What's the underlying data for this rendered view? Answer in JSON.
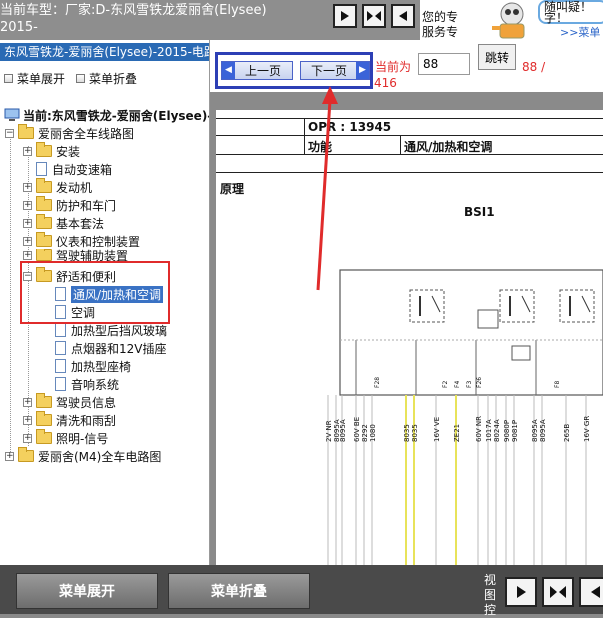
{
  "top": {
    "vehicle_line1": "当前车型：厂家:D-东风雪铁龙爱丽舍(Elysee)",
    "vehicle_line2": "2015-",
    "ad_text_line1": "您的专",
    "ad_text_line2": "服务专",
    "ad_bubble": "随叫疑！字！",
    "ad_menu_link": ">>菜单"
  },
  "tree": {
    "title": "东风雪铁龙-爱丽舍(Elysee)-2015-电路",
    "expand_label": "菜单展开",
    "collapse_label": "菜单折叠",
    "current": "当前:东风雪铁龙-爱丽舍(Elysee)-2",
    "root": "爱丽舍全车线路图",
    "items": [
      "安装",
      "自动变速箱",
      "发动机",
      "防护和车门",
      "基本套法",
      "仪表和控制装置",
      "驾驶辅助装置"
    ],
    "group": "舒适和便利",
    "group_children": [
      "通风/加热和空调",
      "空调",
      "加热型后挡风玻璃",
      "点烟器和12V插座",
      "加热型座椅",
      "音响系统"
    ],
    "items_after": [
      "驾驶员信息",
      "清洗和雨刮",
      "照明-信号"
    ],
    "root2": "爱丽舍(M4)全车电路图"
  },
  "pager": {
    "prev_label": "上一页",
    "next_label": "下一页",
    "current_label": "当前为",
    "current_value": "88",
    "jump_label": "跳转",
    "total": "88 /",
    "total2": "416"
  },
  "doc": {
    "opr": "OPR : 13945",
    "func_label": "功能",
    "func_value": "通风/加热和空调",
    "section": "原理",
    "module": "BSI1",
    "wire_labels": [
      "2V NR",
      "8095A",
      "8095A",
      "60V BE",
      "8292",
      "1080",
      "8035",
      "8035",
      "16V VE",
      "ZE21",
      "60V NR",
      "1017A",
      "8024A",
      "9080P",
      "9081P",
      "8095A",
      "8095A",
      "265B",
      "16V GR"
    ],
    "fuse_labels": [
      "F28",
      "F2",
      "F4",
      "F3",
      "F26",
      "F8"
    ]
  },
  "bottom": {
    "expand_label": "菜单展开",
    "collapse_label": "菜单折叠",
    "view_label": "视图控"
  },
  "colors": {
    "highlight_red": "#e02b2b",
    "title_blue": "#2a6ab4",
    "nav_frame_blue": "#2d3fb5"
  }
}
